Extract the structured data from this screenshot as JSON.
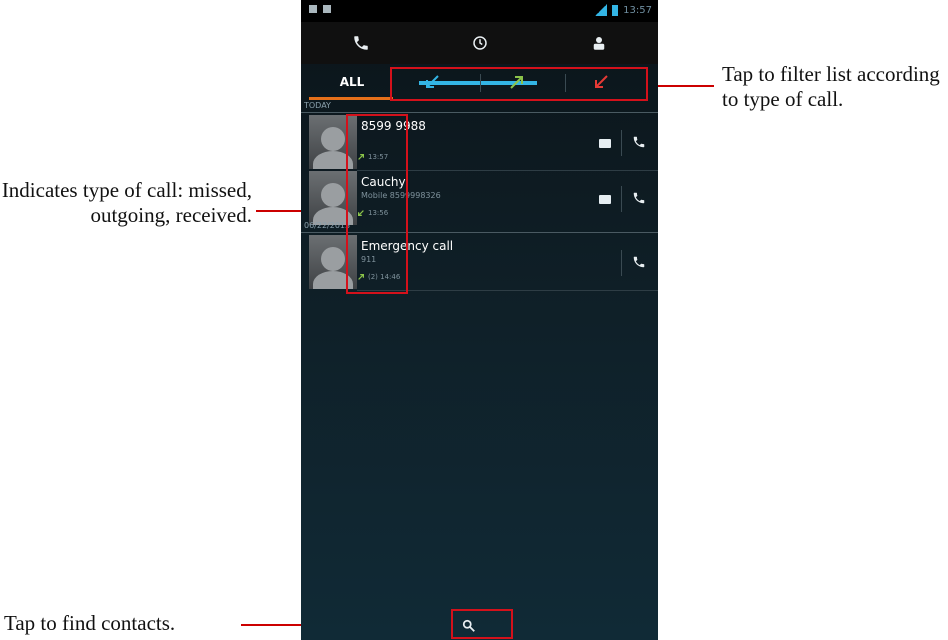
{
  "annotations": {
    "filter_note": "Tap to filter list according to type of call.",
    "type_note": "Indicates type of call: missed, outgoing, received.",
    "search_note": "Tap to find contacts."
  },
  "status_bar": {
    "time": "13:57"
  },
  "tabs": [
    {
      "icon": "phone-icon"
    },
    {
      "icon": "clock-icon",
      "selected": true
    },
    {
      "icon": "contact-icon"
    }
  ],
  "filters": [
    {
      "label": "ALL",
      "selected": true
    },
    {
      "icon": "incoming-arrow-icon",
      "color": "#33b5e5"
    },
    {
      "icon": "outgoing-arrow-icon",
      "color": "#8bc34a"
    },
    {
      "icon": "missed-arrow-icon",
      "color": "#e53935"
    }
  ],
  "sections": [
    {
      "label": "TODAY",
      "calls": [
        {
          "name": "8599 9988",
          "subtitle": "",
          "type": "outgoing",
          "time": "13:57",
          "has_message": true
        },
        {
          "name": "Cauchy",
          "subtitle": "Mobile 8599998326",
          "type": "received",
          "time": "13:56",
          "has_message": true
        }
      ]
    },
    {
      "label": "06/22/2013",
      "calls": [
        {
          "name": "Emergency call",
          "subtitle": "911",
          "type": "outgoing",
          "time": "(2) 14:46",
          "has_message": false
        }
      ]
    }
  ],
  "colors": {
    "accent": "#33b5e5",
    "callout": "#d4111b",
    "all_underline": "#e5701a"
  }
}
